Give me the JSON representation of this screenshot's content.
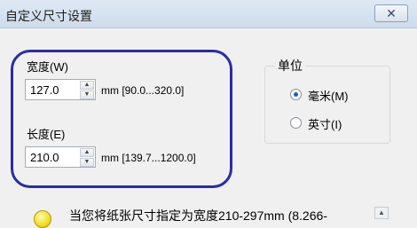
{
  "window": {
    "title": "自定义尺寸设置",
    "close_icon": "✕"
  },
  "width": {
    "label": "宽度(W)",
    "value": "127.0",
    "range": "mm [90.0...320.0]"
  },
  "length": {
    "label": "长度(E)",
    "value": "210.0",
    "range": "mm [139.7...1200.0]"
  },
  "units": {
    "title": "单位",
    "options": [
      {
        "label": "毫米(M)",
        "selected": true
      },
      {
        "label": "英寸(I)",
        "selected": false
      }
    ]
  },
  "info": {
    "text": "当您将纸张尺寸指定为宽度210-297mm (8.266-"
  },
  "icons": {
    "spin_up": "▲",
    "spin_down": "▼"
  },
  "colors": {
    "highlight": "#2b2ba8",
    "radio_selected": "#1a5fb0"
  }
}
